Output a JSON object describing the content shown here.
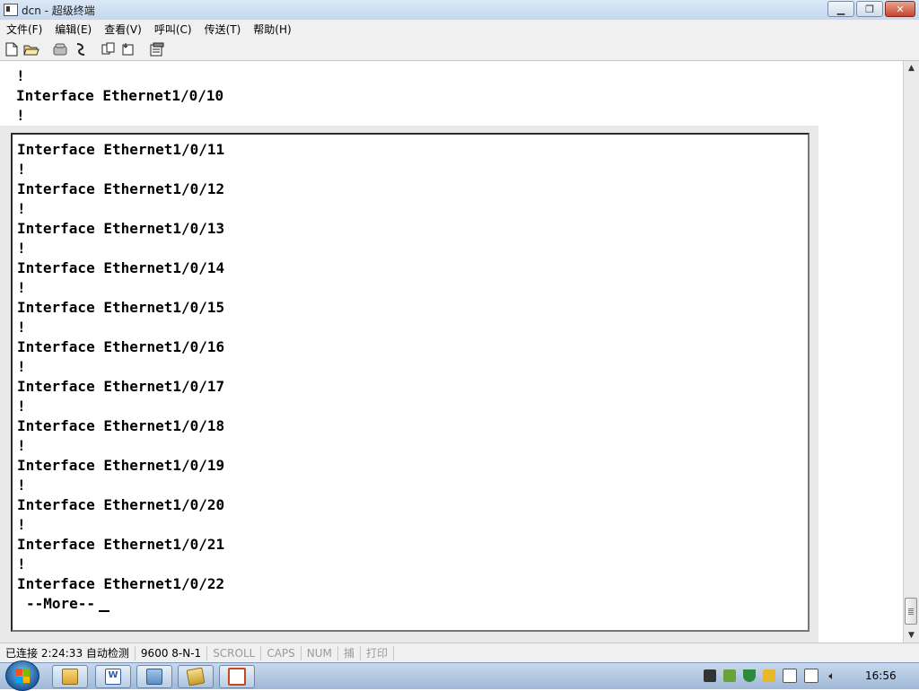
{
  "window": {
    "title": "dcn - 超级终端"
  },
  "menu": [
    "文件(F)",
    "编辑(E)",
    "查看(V)",
    "呼叫(C)",
    "传送(T)",
    "帮助(H)"
  ],
  "toolbar_icons": [
    "new-file-icon",
    "open-folder-icon",
    "call-icon",
    "disconnect-icon",
    "send-icon",
    "receive-icon",
    "properties-icon"
  ],
  "terminal": {
    "top_lines": [
      "!",
      "Interface Ethernet1/0/10",
      "!"
    ],
    "lines": [
      "Interface Ethernet1/0/11",
      "!",
      "Interface Ethernet1/0/12",
      "!",
      "Interface Ethernet1/0/13",
      "!",
      "Interface Ethernet1/0/14",
      "!",
      "Interface Ethernet1/0/15",
      "!",
      "Interface Ethernet1/0/16",
      "!",
      "Interface Ethernet1/0/17",
      "!",
      "Interface Ethernet1/0/18",
      "!",
      "Interface Ethernet1/0/19",
      "!",
      "Interface Ethernet1/0/20",
      "!",
      "Interface Ethernet1/0/21",
      "!",
      "Interface Ethernet1/0/22"
    ],
    "more_prompt": "--More--"
  },
  "status": {
    "connected": "已连接 2:24:33",
    "detect": "自动检测",
    "baud": "9600 8-N-1",
    "scroll": "SCROLL",
    "caps": "CAPS",
    "num": "NUM",
    "capture": "捕",
    "print": "打印"
  },
  "taskbar": {
    "clock": "16:56"
  },
  "colors": {
    "titlebar": "#c5d8ef",
    "close_button": "#c5452d",
    "taskbar": "#9fb8d6"
  }
}
